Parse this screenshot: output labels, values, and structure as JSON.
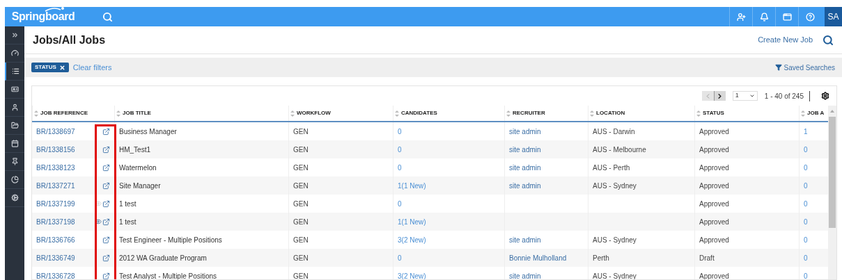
{
  "brand": "Springboard",
  "top_bar": {
    "avatar": "SA"
  },
  "sidebar": {
    "items": [
      {
        "selected": false
      },
      {
        "selected": false
      },
      {
        "selected": true
      },
      {
        "selected": false
      },
      {
        "selected": false
      },
      {
        "selected": false
      },
      {
        "selected": false
      },
      {
        "selected": false
      },
      {
        "selected": false
      },
      {
        "selected": false
      }
    ]
  },
  "page": {
    "title": "Jobs/All Jobs",
    "create_link": "Create New Job"
  },
  "filters": {
    "chips": [
      {
        "label": "STATUS"
      }
    ],
    "clear": "Clear filters",
    "saved": "Saved Searches"
  },
  "pager": {
    "page": "1",
    "range": "1 - 40 of 245"
  },
  "table": {
    "columns": [
      "JOB REFERENCE",
      "JOB TITLE",
      "WORKFLOW",
      "CANDIDATES",
      "RECRUITER",
      "LOCATION",
      "STATUS",
      "JOB A"
    ],
    "rows": [
      {
        "ref": "BR/1338697",
        "eye_visible": false,
        "title": "Business Manager",
        "workflow": "GEN",
        "candidates": "0",
        "recruiter": "site admin",
        "location": "AUS - Darwin",
        "status": "Approved",
        "job_ad": "1"
      },
      {
        "ref": "BR/1338156",
        "eye_visible": false,
        "title": "HM_Test1",
        "workflow": "GEN",
        "candidates": "0",
        "recruiter": "site admin",
        "location": "AUS - Melbourne",
        "status": "Approved",
        "job_ad": "0"
      },
      {
        "ref": "BR/1338123",
        "eye_visible": false,
        "title": "Watermelon",
        "workflow": "GEN",
        "candidates": "0",
        "recruiter": "site admin",
        "location": "AUS - Perth",
        "status": "Approved",
        "job_ad": "0"
      },
      {
        "ref": "BR/1337271",
        "eye_visible": false,
        "title": "Site Manager",
        "workflow": "GEN",
        "candidates": "1(1 New)",
        "recruiter": "site admin",
        "location": "AUS - Sydney",
        "status": "Approved",
        "job_ad": "0"
      },
      {
        "ref": "BR/1337199",
        "eye_visible": true,
        "eye_dark": false,
        "title": "1 test",
        "workflow": "GEN",
        "candidates": "0",
        "status": "Approved",
        "job_ad": "0"
      },
      {
        "ref": "BR/1337198",
        "eye_visible": true,
        "eye_dark": true,
        "title": "1 test",
        "workflow": "GEN",
        "candidates": "1(1 New)",
        "status": "Approved",
        "job_ad": "0"
      },
      {
        "ref": "BR/1336766",
        "eye_visible": false,
        "title": "Test Engineer - Multiple Positions",
        "workflow": "GEN",
        "candidates": "3(2 New)",
        "recruiter": "site admin",
        "location": "AUS - Sydney",
        "status": "Approved",
        "job_ad": "0"
      },
      {
        "ref": "BR/1336749",
        "eye_visible": false,
        "title": "2012 WA Graduate Program",
        "workflow": "GEN",
        "candidates": "0",
        "recruiter": "Bonnie Mulholland",
        "location": "Perth",
        "status": "Draft",
        "job_ad": "0"
      },
      {
        "ref": "BR/1336728",
        "eye_visible": false,
        "title": "Test Analyst - Multiple Positions",
        "workflow": "GEN",
        "candidates": "3(2 New)",
        "recruiter": "site admin",
        "location": "AUS - Sydney",
        "status": "Approved",
        "job_ad": "0"
      }
    ]
  }
}
